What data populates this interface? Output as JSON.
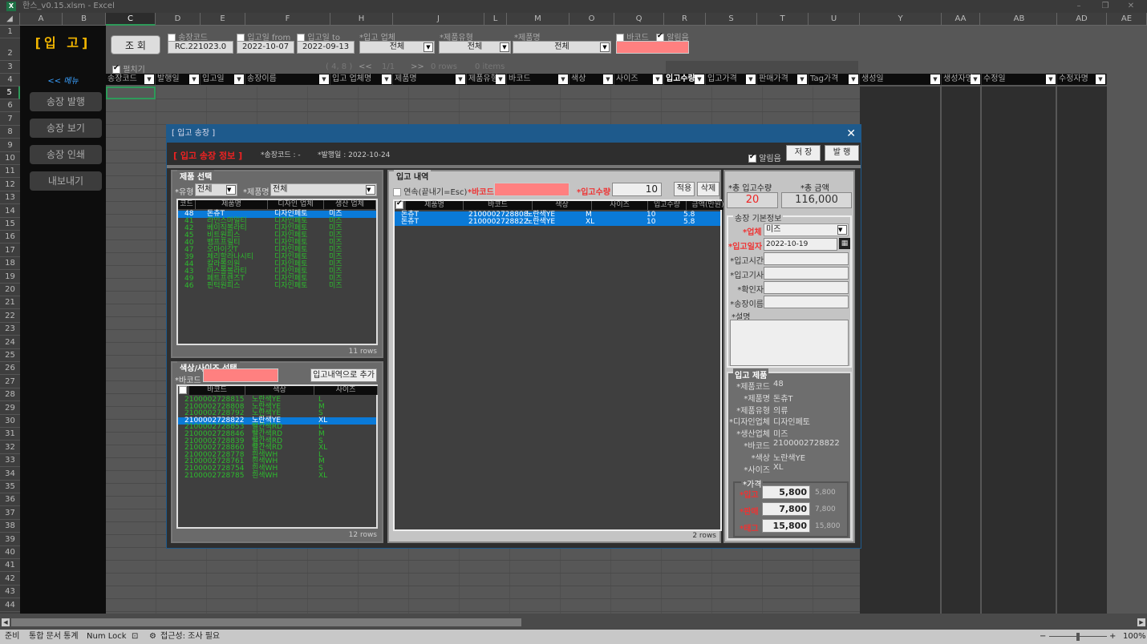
{
  "window": {
    "title": "한스_v0.15.xlsm - Excel",
    "app_icon": "excel-icon"
  },
  "columns": [
    "A",
    "B",
    "C",
    "D",
    "E",
    "F",
    "H",
    "J",
    "L",
    "M",
    "O",
    "Q",
    "R",
    "S",
    "T",
    "U",
    "Y",
    "AA",
    "AB",
    "AD",
    "AE"
  ],
  "rows": [
    "1",
    "2",
    "3",
    "4",
    "5",
    "6",
    "7",
    "8",
    "9",
    "10",
    "11",
    "12",
    "13",
    "14",
    "15",
    "16",
    "17",
    "18",
    "19",
    "20",
    "21",
    "22",
    "23",
    "24",
    "25",
    "26",
    "27",
    "28",
    "29",
    "30",
    "31",
    "32",
    "33",
    "34",
    "35",
    "36",
    "37",
    "38",
    "39",
    "40",
    "41",
    "42",
    "43",
    "44"
  ],
  "sidebar": {
    "title": "[입 고]",
    "menu_link": "<< 메뉴",
    "buttons": [
      "송장 발행",
      "송장 보기",
      "송장 인쇄",
      "내보내기"
    ]
  },
  "search": {
    "query_button": "조 회",
    "invoice_code": {
      "label": "송장코드",
      "checked": false,
      "value": "RC.221023.0"
    },
    "date_from": {
      "label": "입고일 from",
      "checked": false,
      "value": "2022-10-07"
    },
    "date_to": {
      "label": "입고일 to",
      "checked": false,
      "value": "2022-09-13"
    },
    "vendor": {
      "label": "*입고 업체",
      "value": "전체"
    },
    "product_type": {
      "label": "*제품유형",
      "value": "전체"
    },
    "product_name": {
      "label": "*제품명",
      "value": "전체"
    },
    "barcode": {
      "label": "바코드",
      "checked": false
    },
    "alert_sound": {
      "label": "알림음",
      "checked": true
    },
    "expand": {
      "label": "펼치기",
      "checked": true
    },
    "pager": {
      "coords": "( 4, 8 )",
      "prev": "<<",
      "page": "1/1",
      "next": ">>",
      "rows": "0 rows",
      "items": "0 items"
    }
  },
  "table_headers": [
    "송장코드",
    "발행일",
    "입고일",
    "송장이름",
    "입고 업체명",
    "제품명",
    "제품유형",
    "바코드",
    "색상",
    "사이즈",
    "입고수량",
    "입고가격",
    "판매가격",
    "Tag가격",
    "생성일",
    "생성자명",
    "수정일",
    "수정자명"
  ],
  "dialog": {
    "title": "[ 입고 송장 ]",
    "heading": "[ 입고 송장 정보 ]",
    "invoice_code": "*송장코드 : -",
    "issue_date": "*발행일 : 2022-10-24",
    "alert_sound": {
      "label": "알림음",
      "checked": true
    },
    "save_button": "저 장",
    "issue_button": "발 행",
    "product_select": {
      "legend": "제품 선택",
      "type_label": "*유형",
      "type_value": "전체",
      "name_label": "*제품명",
      "name_value": "전체",
      "headers": [
        "코드",
        "제품명",
        "디자인 업체",
        "생산 업체"
      ],
      "rows": [
        [
          "48",
          "돈츄T",
          "디자인페토",
          "미즈"
        ],
        [
          "41",
          "라인스마일티",
          "디자인페토",
          "미즈"
        ],
        [
          "42",
          "베이직볼라티",
          "디자인페토",
          "미즈"
        ],
        [
          "45",
          "비트원피스",
          "디자인페토",
          "미즈"
        ],
        [
          "40",
          "뱀프프릴티",
          "디자인페토",
          "미즈"
        ],
        [
          "47",
          "오마이갓T",
          "디자인페토",
          "미즈"
        ],
        [
          "39",
          "체리할라나시티",
          "디자인페토",
          "미즈"
        ],
        [
          "44",
          "칼라볼의원",
          "디자인페토",
          "미즈"
        ],
        [
          "43",
          "마스볼볼라티",
          "디자인페토",
          "미즈"
        ],
        [
          "49",
          "페트프렌즈T",
          "디자인페토",
          "미즈"
        ],
        [
          "46",
          "핀턱원피스",
          "디자인페토",
          "미즈"
        ]
      ],
      "selected_index": 0,
      "row_count": "11 rows"
    },
    "color_size": {
      "legend": "색상/사이즈 선택",
      "barcode_label": "*바코드",
      "add_button": "입고내역으로 추가",
      "headers": [
        "바코드",
        "색상",
        "사이즈"
      ],
      "rows": [
        [
          "2100002728815",
          "노란색YE",
          "L"
        ],
        [
          "2100002728808",
          "노란색YE",
          "M"
        ],
        [
          "2100002728792",
          "노란색YE",
          "S"
        ],
        [
          "2100002728822",
          "노란색YE",
          "XL"
        ],
        [
          "2100002728853",
          "빨간색RD",
          "L"
        ],
        [
          "2100002728846",
          "빨간색RD",
          "M"
        ],
        [
          "2100002728839",
          "빨간색RD",
          "S"
        ],
        [
          "2100002728860",
          "빨간색RD",
          "XL"
        ],
        [
          "2100002728778",
          "흰색WH",
          "L"
        ],
        [
          "2100002728761",
          "흰색WH",
          "M"
        ],
        [
          "2100002728754",
          "흰색WH",
          "S"
        ],
        [
          "2100002728785",
          "흰색WH",
          "XL"
        ]
      ],
      "selected_index": 3,
      "row_count": "12 rows"
    },
    "receipt": {
      "legend": "입고 내역",
      "continuous_label": "연속(끝내기=Esc)",
      "barcode_label": "*바코드",
      "qty_label": "*입고수량",
      "qty_value": "10",
      "apply_button": "적용",
      "delete_button": "삭제",
      "headers": [
        "제품명",
        "바코드",
        "색상",
        "사이즈",
        "입고수량",
        "금액(만원)"
      ],
      "rows": [
        [
          "돈츄T",
          "2100002728808",
          "노란색YE",
          "M",
          "10",
          "5.8"
        ],
        [
          "돈츄T",
          "2100002728822",
          "노란색YE",
          "XL",
          "10",
          "5.8"
        ]
      ],
      "row_count": "2 rows"
    },
    "totals": {
      "qty_label": "*총 입고수량",
      "qty_value": "20",
      "amount_label": "*총 금액",
      "amount_value": "116,000"
    },
    "basic_info": {
      "legend": "송장 기본정보",
      "vendor_label": "*업체",
      "vendor_value": "미즈",
      "date_label": "*입고일자",
      "date_value": "2022-10-19",
      "time_label": "*입고시간",
      "time_value": "",
      "driver_label": "*입고기사",
      "driver_value": "",
      "checker_label": "*확인자",
      "checker_value": "",
      "name_label": "*송장이름",
      "name_value": "",
      "desc_label": "*설명",
      "desc_value": ""
    },
    "product_info": {
      "legend": "입고 제품",
      "fields": [
        {
          "label": "*제품코드",
          "value": "48"
        },
        {
          "label": "*제품명",
          "value": "돈츄T"
        },
        {
          "label": "*제품유형",
          "value": "의류"
        },
        {
          "label": "*디자인업체",
          "value": "디자인페토"
        },
        {
          "label": "*생산업체",
          "value": "미즈"
        },
        {
          "label": "*바코드",
          "value": "2100002728822"
        },
        {
          "label": "*색상",
          "value": "노란색YE"
        },
        {
          "label": "*사이즈",
          "value": "XL"
        }
      ]
    },
    "price": {
      "legend": "*가격",
      "items": [
        {
          "label": "*입고",
          "value": "5,800",
          "ref": "5,800"
        },
        {
          "label": "*판매",
          "value": "7,800",
          "ref": "7,800"
        },
        {
          "label": "*태그",
          "value": "15,800",
          "ref": "15,800"
        }
      ]
    }
  },
  "statusbar": {
    "ready": "준비",
    "stats": "통합 문서 통계",
    "numlock": "Num Lock",
    "accessibility": "접근성: 조사 필요",
    "zoom": "100%"
  },
  "colors": {
    "pink_input": "#ff8080",
    "selection_blue": "#0a7ad8",
    "list_text_green": "#2dbb2d",
    "title_gold": "#f0b400",
    "red_label": "#e33333",
    "dialog_caption": "#1e5a8c"
  }
}
